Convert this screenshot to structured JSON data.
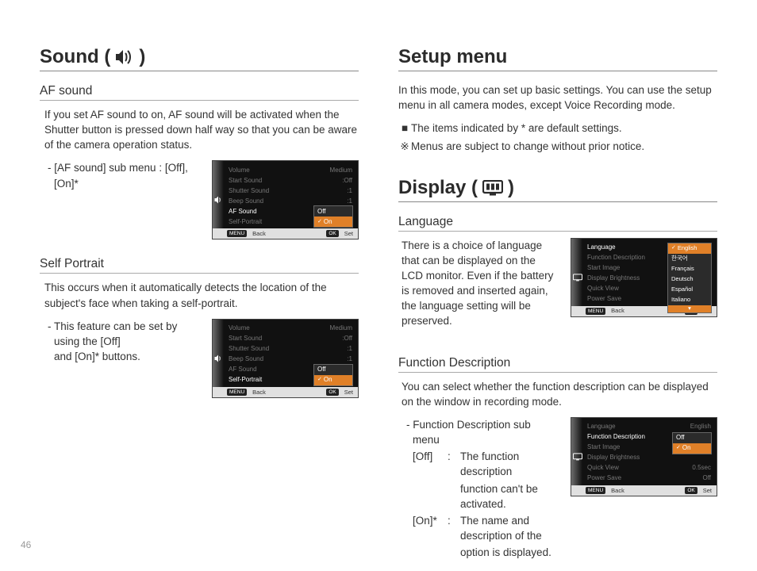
{
  "page_number": "46",
  "left": {
    "title_prefix": "Sound (",
    "title_suffix": " )",
    "af_sound": {
      "heading": "AF sound",
      "desc": "If you set AF sound to on, AF sound will be activated when the Shutter button is pressed down half way so that you can be aware of the camera operation status.",
      "sub": "- [AF sound] sub menu : [Off], [On]*"
    },
    "self_portrait": {
      "heading": "Self Portrait",
      "desc": "This occurs when it automatically detects the location of the subject's face when taking a self-portrait.",
      "sub1": "- This feature can be set by using the [Off]",
      "sub2": "  and [On]* buttons."
    },
    "screen": {
      "rows": [
        {
          "label": "Volume",
          "value": "Medium"
        },
        {
          "label": "Start Sound",
          "value": ":Off"
        },
        {
          "label": "Shutter Sound",
          "value": ":1"
        },
        {
          "label": "Beep Sound",
          "value": ":1"
        },
        {
          "label": "AF Sound",
          "value": ""
        },
        {
          "label": "Self-Portrait",
          "value": ""
        }
      ],
      "popup": {
        "off": "Off",
        "on": "On"
      },
      "footer": {
        "back_tag": "MENU",
        "back": "Back",
        "set_tag": "OK",
        "set": "Set"
      }
    }
  },
  "right": {
    "setup": {
      "title": "Setup menu",
      "desc": "In this mode, you can set up basic settings. You can use the setup menu in all camera modes, except Voice Recording mode.",
      "bullet1_mark": "■",
      "bullet1": "The items indicated by * are default settings.",
      "bullet2_mark": "※",
      "bullet2": "Menus are subject to change without prior notice."
    },
    "display": {
      "title_prefix": "Display (",
      "title_suffix": " )"
    },
    "language": {
      "heading": "Language",
      "desc": "There is a choice of language that can be displayed on the LCD monitor. Even if the battery is removed and inserted again, the language setting will be preserved.",
      "screen": {
        "rows": [
          {
            "label": "Language",
            "value": ""
          },
          {
            "label": "Function Description",
            "value": ""
          },
          {
            "label": "Start Image",
            "value": ""
          },
          {
            "label": "Display  Brightness",
            "value": ""
          },
          {
            "label": "Quick View",
            "value": ""
          },
          {
            "label": "Power Save",
            "value": ""
          }
        ],
        "popup": [
          "English",
          "한국어",
          "Français",
          "Deutsch",
          "Español",
          "Italiano"
        ],
        "footer": {
          "back_tag": "MENU",
          "back": "Back",
          "set_tag": "OK",
          "set": "Set"
        }
      }
    },
    "func": {
      "heading": "Function Description",
      "desc": "You can select whether the function description can be displayed on the window in recording mode.",
      "sub0": "- Function Description sub menu",
      "off_k": "[Off]",
      "off_v1": "The function description",
      "off_v2": "function can't be activated.",
      "on_k": "[On]*",
      "on_v1": "The name and description of the",
      "on_v2": "option is displayed.",
      "colon": ":",
      "screen": {
        "rows": [
          {
            "label": "Language",
            "value": "English"
          },
          {
            "label": "Function Description",
            "value": ""
          },
          {
            "label": "Start Image",
            "value": ""
          },
          {
            "label": "Display  Brightness",
            "value": ""
          },
          {
            "label": "Quick View",
            "value": "0.5sec"
          },
          {
            "label": "Power Save",
            "value": "Off"
          }
        ],
        "popup": {
          "off": "Off",
          "on": "On"
        },
        "footer": {
          "back_tag": "MENU",
          "back": "Back",
          "set_tag": "OK",
          "set": "Set"
        }
      }
    }
  }
}
